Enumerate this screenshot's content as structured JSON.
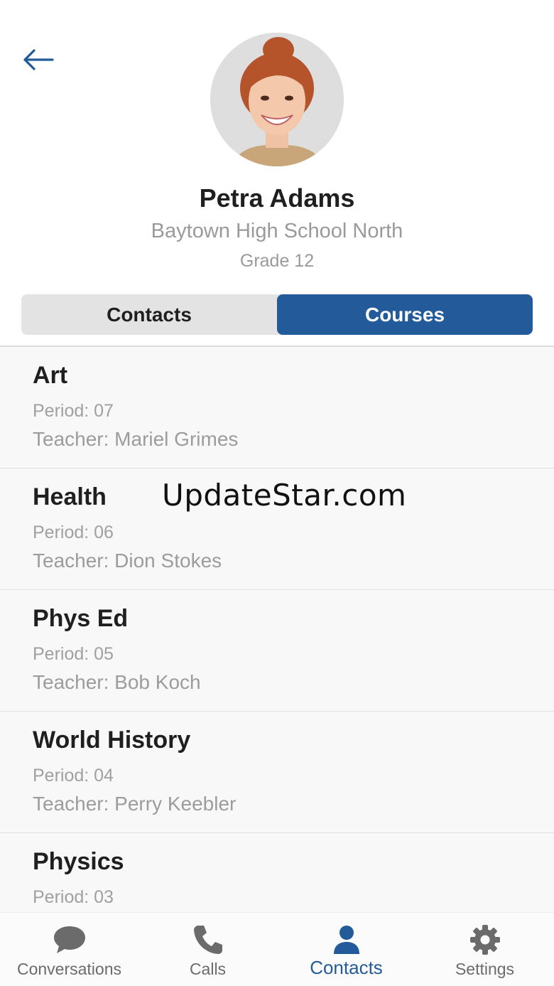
{
  "profile": {
    "name": "Petra Adams",
    "school": "Baytown High School North",
    "grade": "Grade 12"
  },
  "tabs": {
    "contacts_label": "Contacts",
    "courses_label": "Courses",
    "active": "Courses"
  },
  "courses": [
    {
      "title": "Art",
      "period": "Period: 07",
      "teacher": "Teacher: Mariel Grimes"
    },
    {
      "title": "Health",
      "period": "Period: 06",
      "teacher": "Teacher: Dion Stokes"
    },
    {
      "title": "Phys Ed",
      "period": "Period: 05",
      "teacher": "Teacher: Bob Koch"
    },
    {
      "title": "World History",
      "period": "Period: 04",
      "teacher": "Teacher: Perry Keebler"
    },
    {
      "title": "Physics",
      "period": "Period: 03",
      "teacher": ""
    }
  ],
  "watermark": "UpdateStar.com",
  "nav": {
    "conversations": "Conversations",
    "calls": "Calls",
    "contacts": "Contacts",
    "settings": "Settings",
    "active": "Contacts"
  },
  "colors": {
    "accent": "#235a99",
    "muted_text": "#9a9a9a",
    "icon_gray": "#6b6b6b"
  },
  "icons": {
    "back": "arrow-left-icon",
    "conversations": "chat-bubble-icon",
    "calls": "phone-icon",
    "contacts": "person-icon",
    "settings": "gear-icon"
  }
}
